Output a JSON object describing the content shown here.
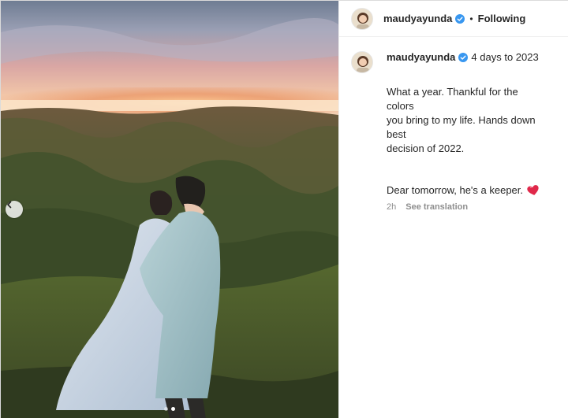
{
  "header": {
    "username": "maudyayunda",
    "separator": "•",
    "follow_label": "Following"
  },
  "caption": {
    "username": "maudyayunda",
    "title": "4 days to 2023",
    "paragraph1": "What a year. Thankful for the colors\nyou bring to my life. Hands down best\ndecision of 2022.",
    "paragraph2": "Dear tomorrow, he's a keeper.",
    "time": "2h",
    "see_translation": "See translation"
  },
  "carousel": {
    "total": 2,
    "current": 2
  },
  "icons": {
    "verified": "verified-badge-icon",
    "heart": "red-heart-emoji-icon",
    "prev": "chevron-left-icon"
  },
  "colors": {
    "verified_blue": "#3897f0",
    "heart_red": "#e0284a",
    "muted_text": "#8e8e8e"
  }
}
